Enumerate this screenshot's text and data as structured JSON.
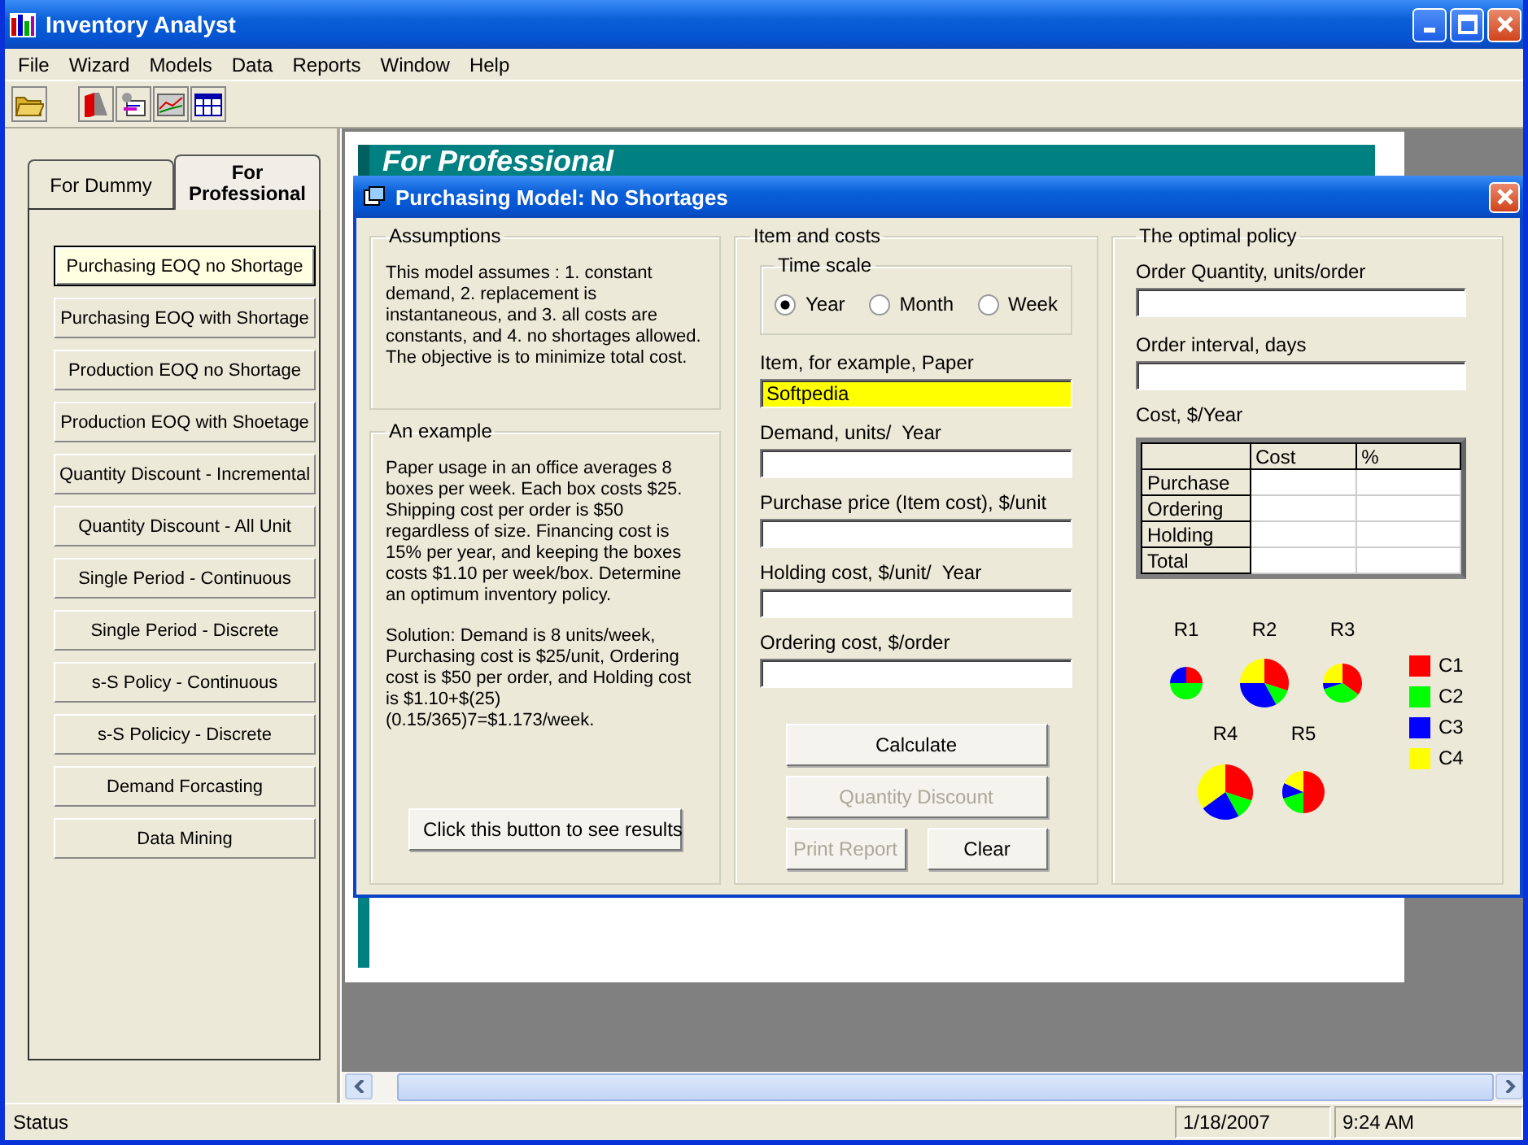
{
  "window": {
    "title": "Inventory Analyst"
  },
  "menu": [
    "File",
    "Wizard",
    "Models",
    "Data",
    "Reports",
    "Window",
    "Help"
  ],
  "sidebar": {
    "tabs": [
      {
        "label": "For Dummy",
        "selected": false
      },
      {
        "label": "For Professional",
        "selected": true
      }
    ],
    "models": [
      {
        "label": "Purchasing EOQ no Shortage",
        "selected": true
      },
      {
        "label": "Purchasing EOQ with Shortage",
        "selected": false
      },
      {
        "label": "Production EOQ no Shortage",
        "selected": false
      },
      {
        "label": "Production EOQ with Shoetage",
        "selected": false
      },
      {
        "label": "Quantity Discount - Incremental",
        "selected": false
      },
      {
        "label": "Quantity Discount - All Unit",
        "selected": false
      },
      {
        "label": "Single Period - Continuous",
        "selected": false
      },
      {
        "label": "Single Period - Discrete",
        "selected": false
      },
      {
        "label": "s-S Policy - Continuous",
        "selected": false
      },
      {
        "label": "s-S Policicy - Discrete",
        "selected": false
      },
      {
        "label": "Demand Forcasting",
        "selected": false
      },
      {
        "label": "Data Mining",
        "selected": false
      }
    ]
  },
  "document": {
    "heading": "For Professional"
  },
  "dialog": {
    "title": "Purchasing Model: No Shortages",
    "assumptions": {
      "title": "Assumptions",
      "text": "This model assumes : 1. constant demand, 2. replacement is instantaneous, and 3. all costs are constants, and 4. no shortages allowed. The objective is to minimize total cost."
    },
    "example": {
      "title": "An example",
      "paragraphs": [
        "Paper usage in an office averages 8 boxes per week. Each box costs $25. Shipping cost per order is $50 regardless of size. Financing cost is 15% per year, and keeping the boxes costs $1.10 per week/box. Determine an optimum inventory policy.",
        "Solution: Demand is 8 units/week, Purchasing cost is $25/unit, Ordering cost is $50 per order, and Holding cost is $1.10+$(25)(0.15/365)7=$1.173/week."
      ],
      "button": "Click this button to see results"
    },
    "item_costs": {
      "title": "Item and costs",
      "time_scale": {
        "title": "Time scale",
        "options": [
          {
            "label": "Year",
            "selected": true
          },
          {
            "label": "Month",
            "selected": false
          },
          {
            "label": "Week",
            "selected": false
          }
        ]
      },
      "fields": [
        {
          "label": "Item, for example, Paper",
          "value": "Softpedia",
          "focused": true
        },
        {
          "label": "Demand, units/  Year",
          "focused": false
        },
        {
          "label": "Purchase price (Item cost), $/unit",
          "focused": false
        },
        {
          "label": "Holding cost, $/unit/  Year",
          "focused": false
        },
        {
          "label": "Ordering cost, $/order",
          "focused": false
        }
      ],
      "buttons": [
        {
          "label": "Calculate",
          "disabled": false
        },
        {
          "label": "Quantity Discount",
          "disabled": true
        },
        {
          "label": "Print Report",
          "disabled": true
        },
        {
          "label": "Clear",
          "disabled": false
        }
      ]
    },
    "policy": {
      "title": "The optimal policy",
      "fields": [
        {
          "label": "Order Quantity, units/order"
        },
        {
          "label": "Order interval, days"
        }
      ],
      "cost_title": "Cost, $/Year",
      "table": {
        "columns": [
          "Cost",
          "%"
        ],
        "rows": [
          "Purchase",
          "Ordering",
          "Holding",
          "Total"
        ]
      },
      "pies": [
        "R1",
        "R2",
        "R3",
        "R4",
        "R5"
      ],
      "legend": [
        {
          "label": "C1",
          "color": "#ff0000"
        },
        {
          "label": "C2",
          "color": "#00ff00"
        },
        {
          "label": "C3",
          "color": "#0000ff"
        },
        {
          "label": "C4",
          "color": "#ffff00"
        }
      ]
    }
  },
  "status_bar": [
    "Status",
    "1/18/2007",
    "9:24 AM"
  ]
}
